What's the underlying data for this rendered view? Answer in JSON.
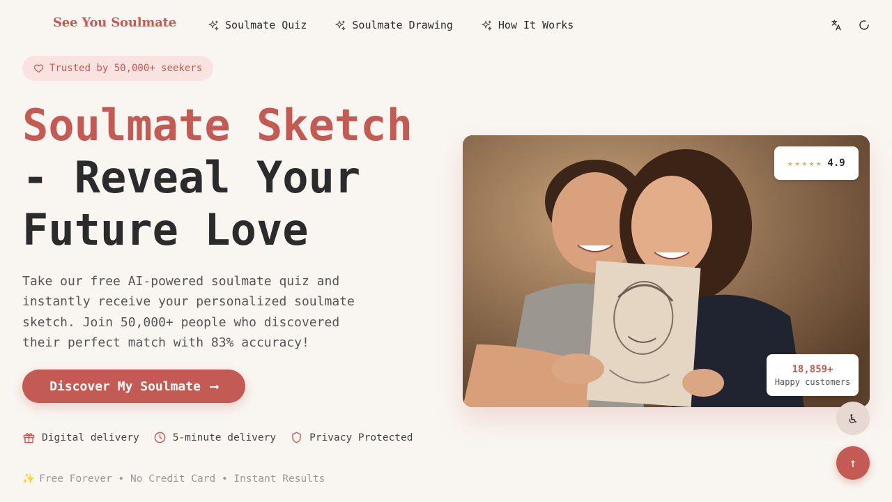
{
  "header": {
    "logo": "See You Soulmate",
    "nav": [
      {
        "label": "Soulmate Quiz",
        "icon": "sparkles-icon"
      },
      {
        "label": "Soulmate Drawing",
        "icon": "sparkles-icon"
      },
      {
        "label": "How It Works",
        "icon": "sparkles-icon"
      }
    ],
    "icons": [
      "translate-icon",
      "loading-icon"
    ]
  },
  "hero": {
    "badge": "Trusted by 50,000+ seekers",
    "title_accent": "Soulmate Sketch",
    "title_rest": "- Reveal Your Future Love",
    "description": "Take our free AI-powered soulmate quiz and instantly receive your personalized soulmate sketch. Join 50,000+ people who discovered their perfect match with 83% accuracy!",
    "cta_label": "Discover My Soulmate",
    "cta_arrow": "⟶",
    "features": [
      {
        "icon": "gift-icon",
        "label": "Digital delivery"
      },
      {
        "icon": "clock-icon",
        "label": "5-minute delivery"
      },
      {
        "icon": "shield-icon",
        "label": "Privacy Protected"
      }
    ],
    "footnote_emoji": "✨",
    "footnote": "Free Forever • No Credit Card • Instant Results"
  },
  "photo": {
    "stars": "★★★★★",
    "rating": "4.9",
    "customers_count": "18,859+",
    "customers_label": "Happy customers"
  },
  "floating": {
    "accessibility_glyph": "♿",
    "to_top_glyph": "↑"
  },
  "colors": {
    "accent": "#c45a54",
    "background": "#f9f6f1",
    "star": "#e0a860"
  }
}
